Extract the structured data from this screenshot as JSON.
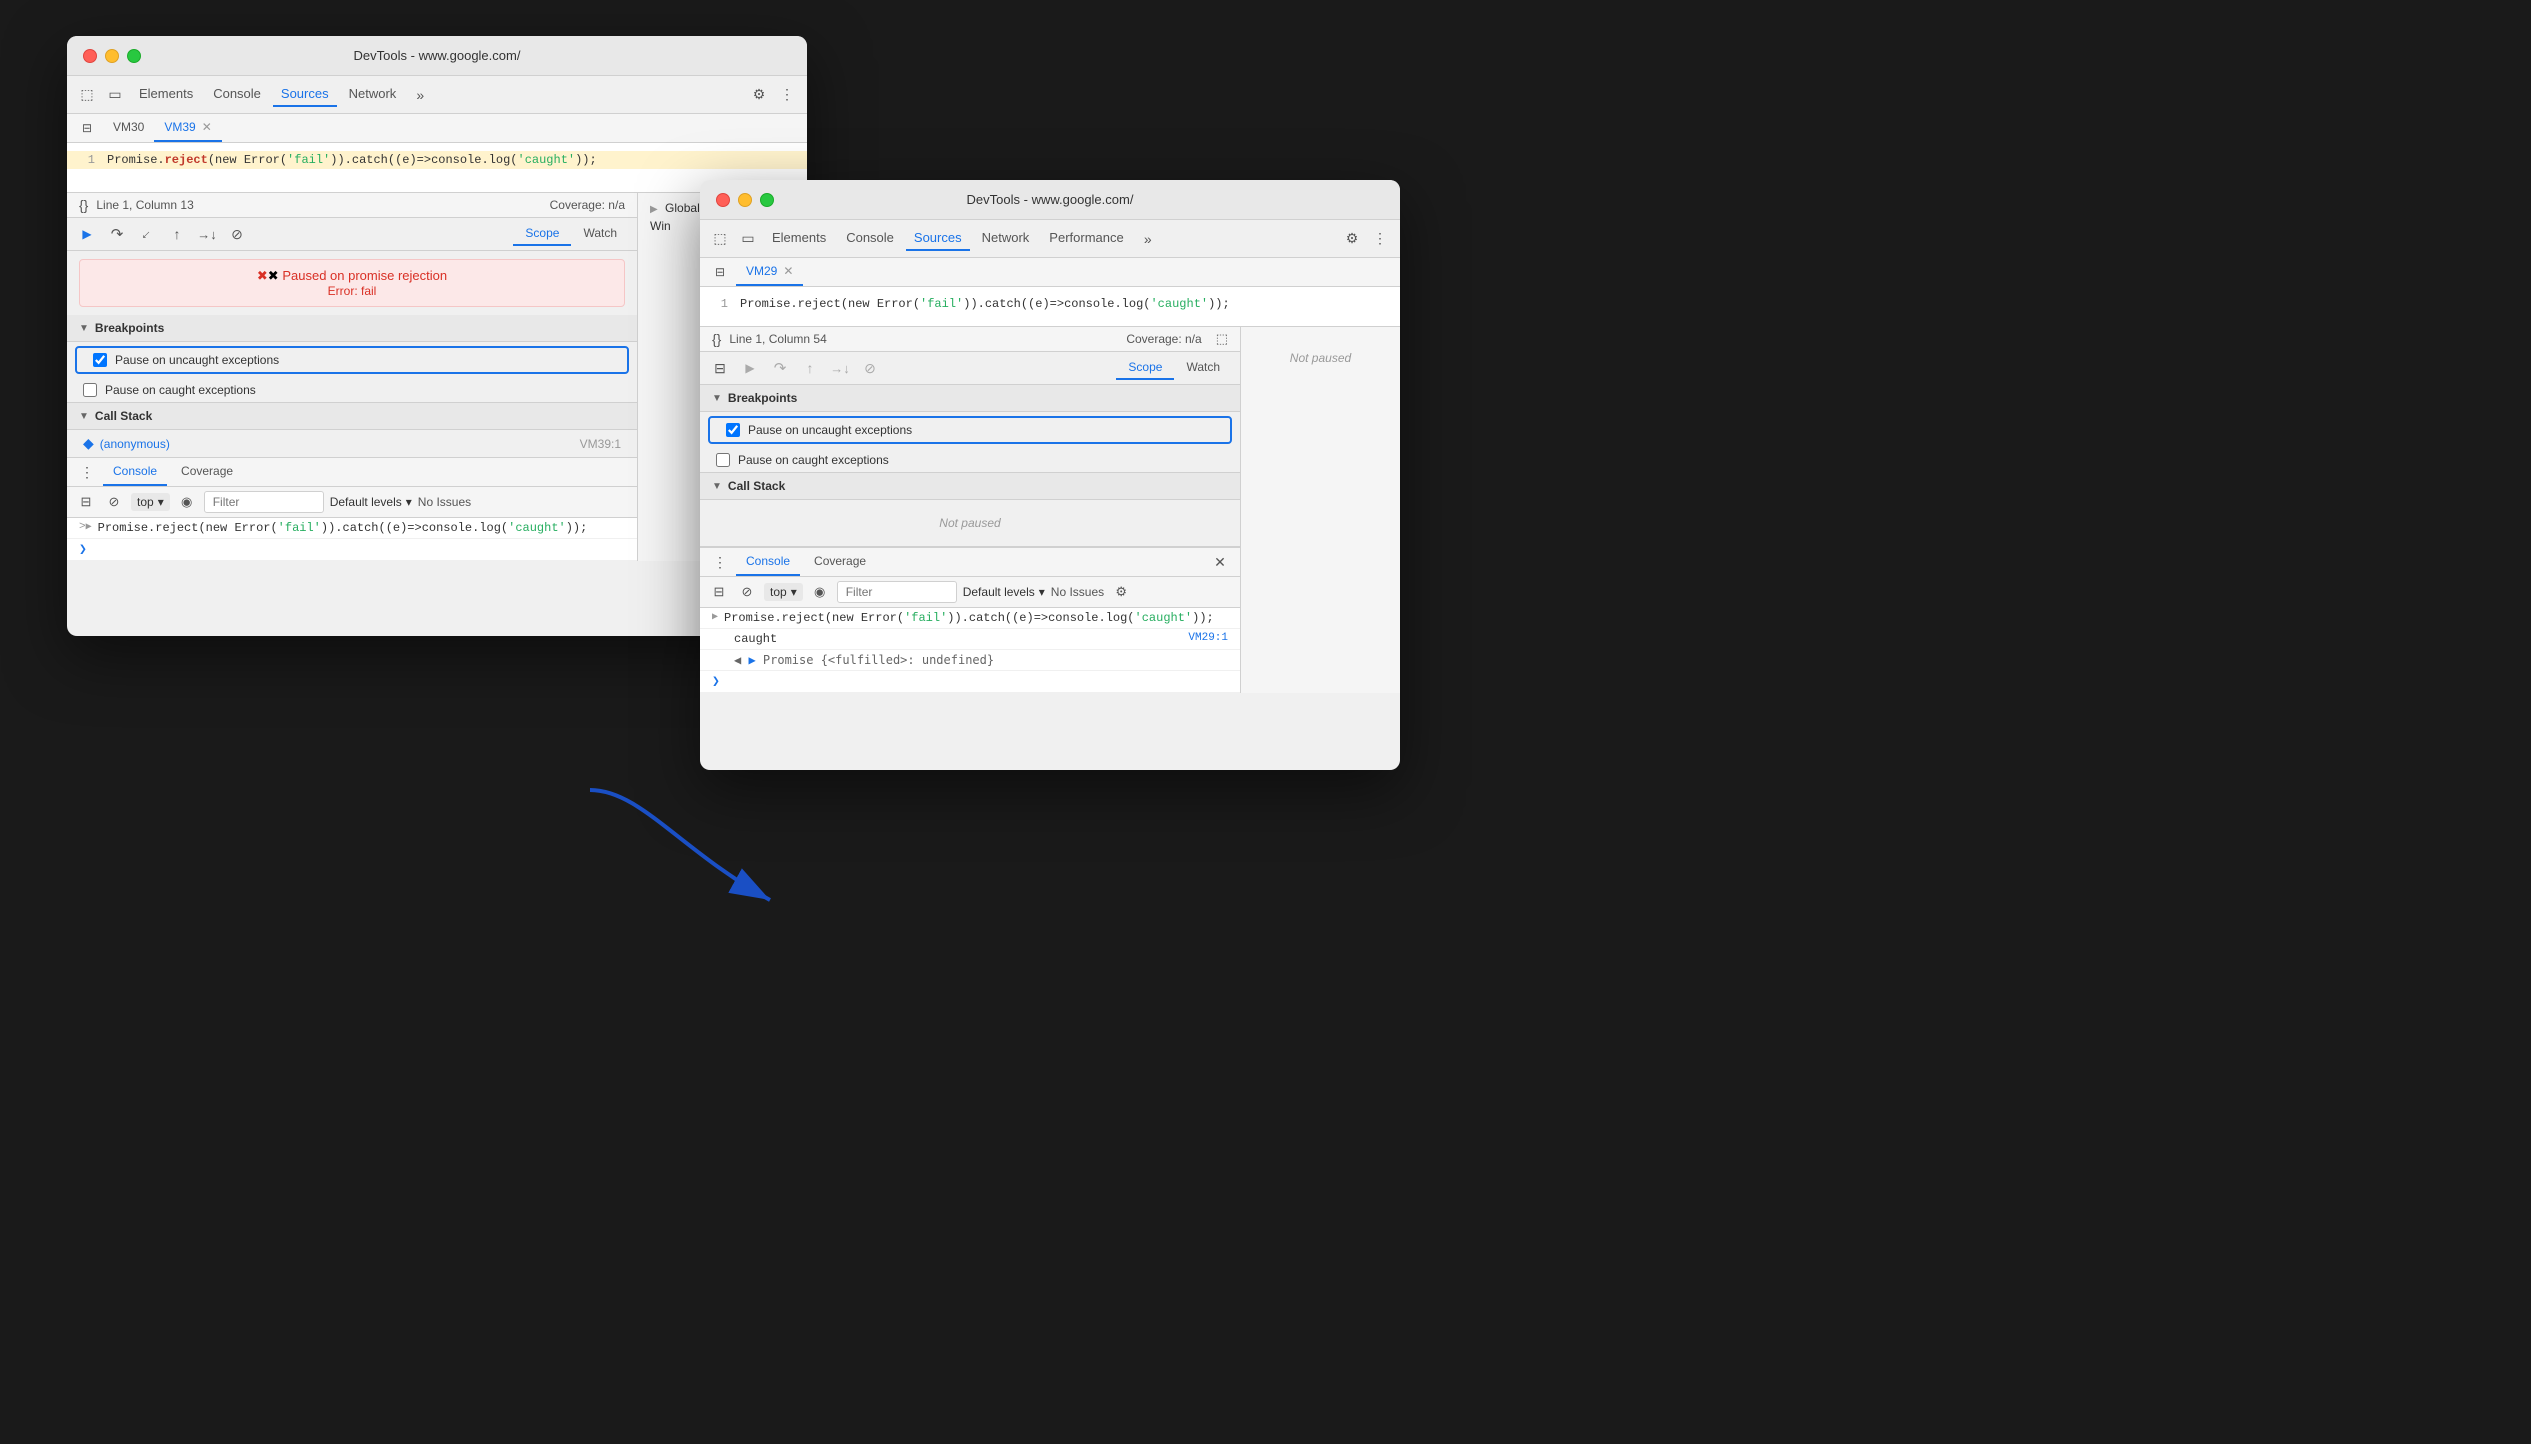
{
  "window1": {
    "title": "DevTools - www.google.com/",
    "tabs": [
      "Elements",
      "Console",
      "Sources",
      "Network"
    ],
    "active_tab": "Sources",
    "file_tabs": [
      "VM30",
      "VM39"
    ],
    "active_file_tab": "VM39",
    "code": {
      "line1": "Promise.reject(new Error('fail')).catch((e)=>console.log('caught'));"
    },
    "status": {
      "position": "Line 1, Column 13",
      "coverage": "Coverage: n/a"
    },
    "paused_message": "Paused on promise rejection",
    "error_message": "Error: fail",
    "breakpoints_label": "Breakpoints",
    "pause_uncaught": "Pause on uncaught exceptions",
    "pause_caught": "Pause on caught exceptions",
    "call_stack_label": "Call Stack",
    "call_stack_item": "(anonymous)",
    "call_stack_loc": "VM39:1",
    "scope_label": "Scope",
    "watch_label": "Watch",
    "console_tab": "Console",
    "coverage_tab": "Coverage",
    "top_label": "top",
    "filter_placeholder": "Filter",
    "default_levels": "Default levels",
    "no_issues": "No Issues",
    "console_line1": "Promise.reject(new Error('fail')).catch((e)=>console.log('caught'));",
    "global_label": "Global",
    "win_label": "Win"
  },
  "window2": {
    "title": "DevTools - www.google.com/",
    "tabs": [
      "Elements",
      "Console",
      "Sources",
      "Network",
      "Performance"
    ],
    "active_tab": "Sources",
    "file_tabs": [
      "VM29"
    ],
    "active_file_tab": "VM29",
    "code": {
      "line1": "Promise.reject(new Error('fail')).catch((e)=>console.log('caught'));"
    },
    "status": {
      "position": "Line 1, Column 54",
      "coverage": "Coverage: n/a"
    },
    "breakpoints_label": "Breakpoints",
    "pause_uncaught": "Pause on uncaught exceptions",
    "pause_caught": "Pause on caught exceptions",
    "call_stack_label": "Call Stack",
    "not_paused": "Not paused",
    "scope_label": "Scope",
    "watch_label": "Watch",
    "scope_not_paused": "Not paused",
    "console_tab": "Console",
    "coverage_tab": "Coverage",
    "top_label": "top",
    "filter_placeholder": "Filter",
    "default_levels": "Default levels",
    "no_issues": "No Issues",
    "console_line1": "Promise.reject(new Error('fail')).catch((e)=>console.log('caught'));",
    "console_line2": "caught",
    "console_loc2": "VM29:1",
    "console_line3": "◀ Promise {<fulfilled>: undefined}",
    "close_label": "✕"
  },
  "icons": {
    "inspect": "⬚",
    "device": "▭",
    "gear": "⚙",
    "more": "⋮",
    "chevron": "»",
    "resume": "▶",
    "step_over": "↷",
    "step_into": "↓",
    "step_out": "↑",
    "step": "→",
    "deactivate": "⊘",
    "eye": "◉",
    "ban": "⊘",
    "triangle_right": "▶",
    "triangle_down": "▼",
    "blue_dot": "◆"
  }
}
